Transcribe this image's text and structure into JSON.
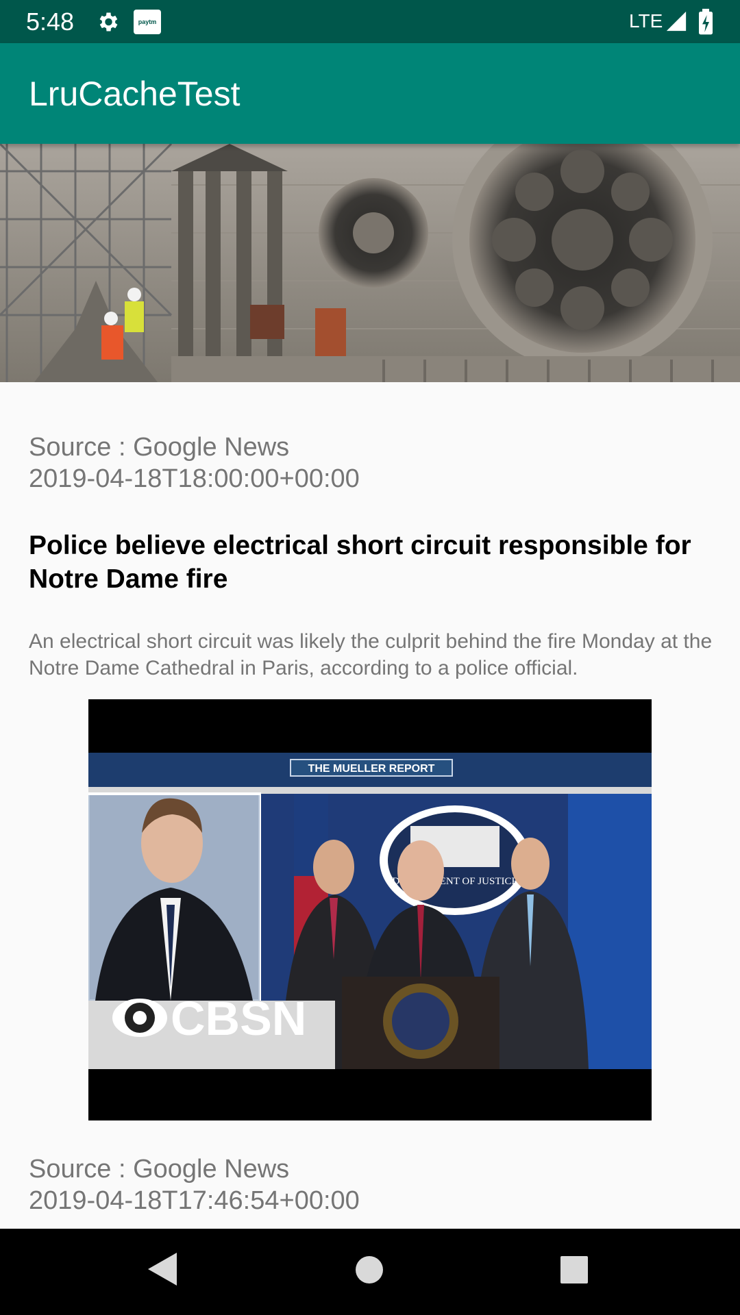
{
  "status_bar": {
    "time": "5:48",
    "network": "LTE",
    "icons": [
      "gear-icon",
      "paytm-icon",
      "signal-icon",
      "battery-charging-icon"
    ]
  },
  "app_bar": {
    "title": "LruCacheTest",
    "color": "#008577"
  },
  "articles": [
    {
      "image": "notre-dame-facade-photo",
      "source": "Source : Google News",
      "published": "2019-04-18T18:00:00+00:00",
      "title": "Police believe electrical short circuit responsible for Notre Dame fire",
      "description": "An electrical short circuit was likely the culprit behind the fire Monday at the Notre Dame Cathedral in Paris, according to a police official."
    },
    {
      "image": "cbsn-mueller-report-video-thumbnail",
      "thumbnail_text": {
        "banner": "THE MUELLER REPORT",
        "seal": "DEPARTMENT OF JUSTICE",
        "logo": "CBSN"
      },
      "source": "Source : Google News",
      "published": "2019-04-18T17:46:54+00:00"
    }
  ],
  "nav_bar": {
    "icons": [
      "back-icon",
      "home-icon",
      "recents-icon"
    ]
  }
}
